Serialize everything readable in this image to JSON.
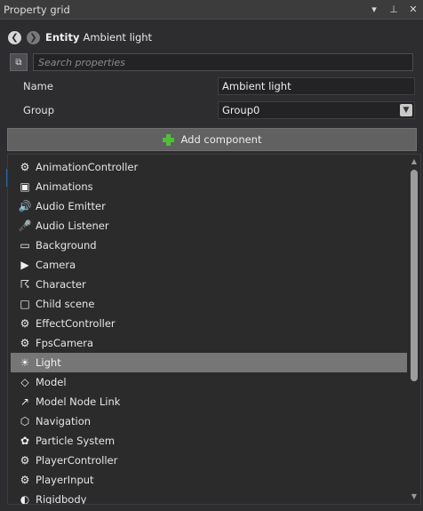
{
  "window": {
    "title": "Property grid",
    "controls": {
      "menu": "▾",
      "pin": "⊥",
      "close": "✕"
    }
  },
  "entity": {
    "label": "Entity",
    "name": "Ambient light",
    "back_icon": "arrow-left-icon",
    "forward_icon": "arrow-right-icon"
  },
  "search": {
    "placeholder": "Search properties",
    "value": ""
  },
  "properties": {
    "name_label": "Name",
    "name_value": "Ambient light",
    "group_label": "Group",
    "group_value": "Group0"
  },
  "add_component": {
    "label": "Add component",
    "icon": "plus-icon",
    "accent_color": "#4fbf3a"
  },
  "components": [
    {
      "label": "AnimationController",
      "icon": "gear-icon"
    },
    {
      "label": "Animations",
      "icon": "film-icon"
    },
    {
      "label": "Audio Emitter",
      "icon": "speaker-icon"
    },
    {
      "label": "Audio Listener",
      "icon": "microphone-icon"
    },
    {
      "label": "Background",
      "icon": "monitor-icon"
    },
    {
      "label": "Camera",
      "icon": "camera-icon"
    },
    {
      "label": "Character",
      "icon": "character-icon"
    },
    {
      "label": "Child scene",
      "icon": "child-scene-icon"
    },
    {
      "label": "EffectController",
      "icon": "gear-icon"
    },
    {
      "label": "FpsCamera",
      "icon": "gear-icon"
    },
    {
      "label": "Light",
      "icon": "light-icon",
      "selected": true
    },
    {
      "label": "Model",
      "icon": "model-icon"
    },
    {
      "label": "Model Node Link",
      "icon": "link-icon"
    },
    {
      "label": "Navigation",
      "icon": "navigation-icon"
    },
    {
      "label": "Particle System",
      "icon": "flame-icon"
    },
    {
      "label": "PlayerController",
      "icon": "gear-icon"
    },
    {
      "label": "PlayerInput",
      "icon": "gear-icon"
    },
    {
      "label": "Rigidbody",
      "icon": "rigidbody-icon"
    }
  ],
  "colors": {
    "background": "#2d2d30",
    "selected_row": "#767676",
    "button": "#616161"
  }
}
